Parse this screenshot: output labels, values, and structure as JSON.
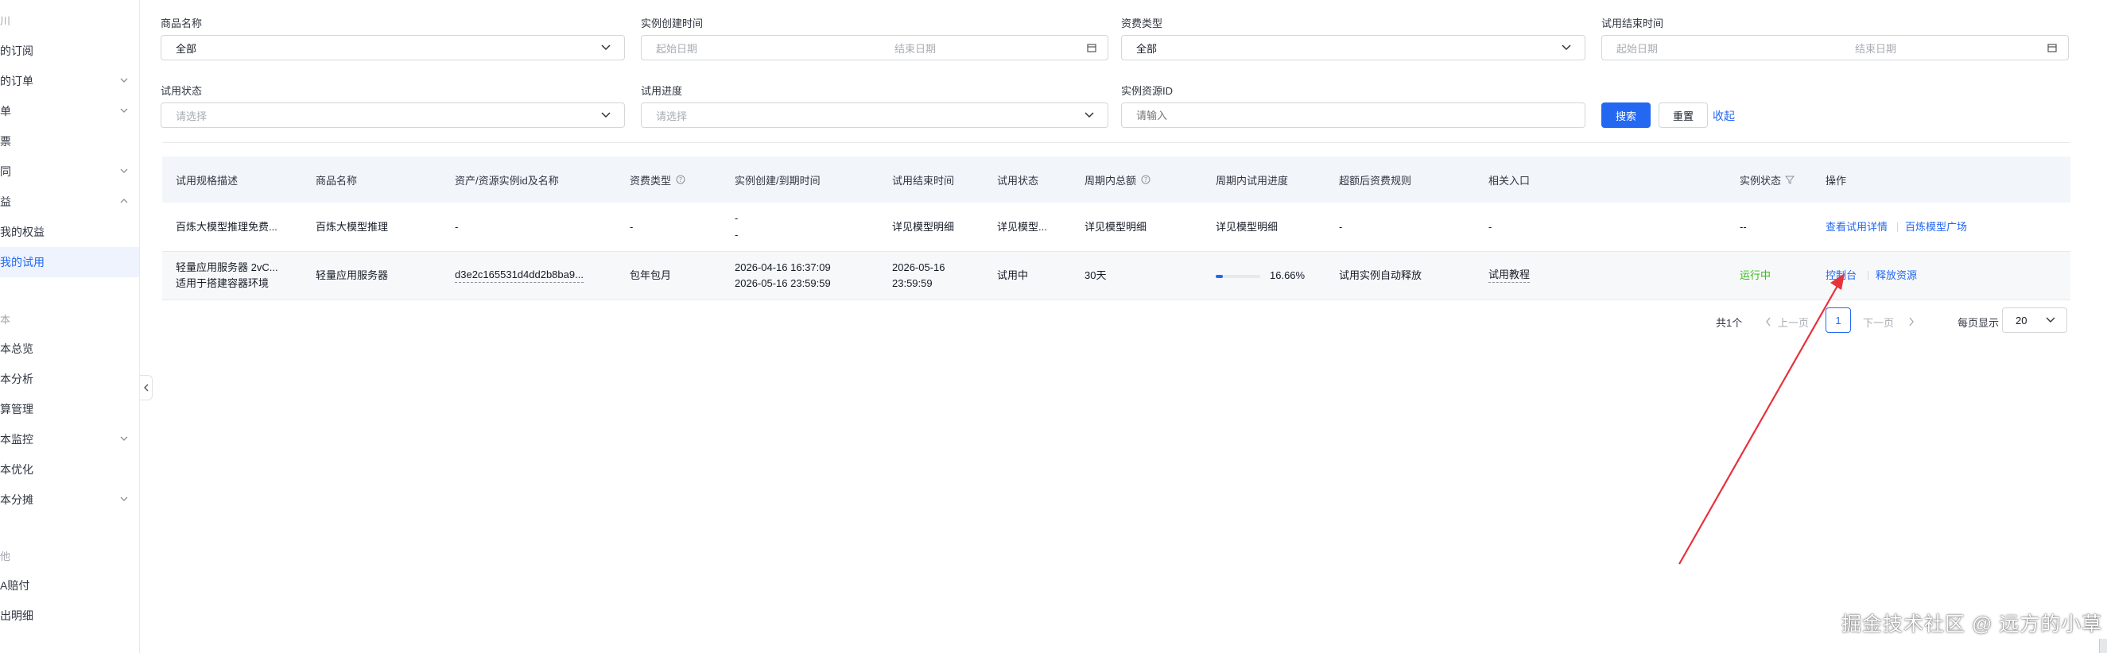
{
  "sidebar": {
    "items": [
      {
        "label": "川",
        "chevron": false,
        "group": true
      },
      {
        "label": "的订阅",
        "chevron": false
      },
      {
        "label": "的订单",
        "chevron": true
      },
      {
        "label": "单",
        "chevron": true
      },
      {
        "label": "票",
        "chevron": false
      },
      {
        "label": "同",
        "chevron": true
      },
      {
        "label": "益",
        "chevron": true,
        "up": true
      },
      {
        "label": "我的权益",
        "chevron": false
      },
      {
        "label": "我的试用",
        "chevron": false,
        "active": true
      },
      {
        "label": "本",
        "chevron": false,
        "group": true
      },
      {
        "label": "本总览",
        "chevron": false
      },
      {
        "label": "本分析",
        "chevron": false
      },
      {
        "label": "算管理",
        "chevron": false
      },
      {
        "label": "本监控",
        "chevron": true
      },
      {
        "label": "本优化",
        "chevron": false
      },
      {
        "label": "本分摊",
        "chevron": true
      },
      {
        "label": "他",
        "chevron": false,
        "group": true
      },
      {
        "label": "A赔付",
        "chevron": false
      },
      {
        "label": "出明细",
        "chevron": false
      }
    ]
  },
  "filters": {
    "product_name": {
      "label": "商品名称",
      "value": "全部"
    },
    "create_time": {
      "label": "实例创建时间",
      "start_placeholder": "起始日期",
      "end_placeholder": "结束日期"
    },
    "billing_type": {
      "label": "资费类型",
      "value": "全部"
    },
    "trial_end_time": {
      "label": "试用结束时间",
      "start_placeholder": "起始日期",
      "end_placeholder": "结束日期"
    },
    "trial_status": {
      "label": "试用状态",
      "placeholder": "请选择"
    },
    "trial_progress": {
      "label": "试用进度",
      "placeholder": "请选择"
    },
    "resource_id": {
      "label": "实例资源ID",
      "placeholder": "请输入"
    },
    "search_label": "搜索",
    "reset_label": "重置",
    "collapse_label": "收起"
  },
  "table": {
    "headers": [
      "试用规格描述",
      "商品名称",
      "资产/资源实例id及名称",
      "资费类型",
      "实例创建/到期时间",
      "试用结束时间",
      "试用状态",
      "周期内总额",
      "周期内试用进度",
      "超额后资费规则",
      "相关入口",
      "实例状态",
      "操作"
    ],
    "rows": [
      {
        "spec": "百炼大模型推理免费...",
        "product": "百炼大模型推理",
        "instance": "-",
        "billing": "-",
        "time_create": "-",
        "time_expire": "-",
        "trial_end": "详见模型明细",
        "trial_status": "详见模型...",
        "total": "详见模型明细",
        "progress_text": "详见模型明细",
        "overage": "-",
        "entry": "-",
        "instance_status": "--",
        "action1": "查看试用详情",
        "action2": "百炼模型广场"
      },
      {
        "spec": "轻量应用服务器 2vC...",
        "spec2": "适用于搭建容器环境",
        "product": "轻量应用服务器",
        "instance": "d3e2c165531d4dd2b8ba9...",
        "billing": "包年包月",
        "time_create": "2026-04-16 16:37:09",
        "time_expire": "2026-05-16 23:59:59",
        "trial_end": "2026-05-16",
        "trial_end2": "23:59:59",
        "trial_status": "试用中",
        "total": "30天",
        "progress_value": 16.66,
        "progress_text": "16.66%",
        "overage": "试用实例自动释放",
        "entry": "试用教程",
        "instance_status": "运行中",
        "action1": "控制台",
        "action2": "释放资源"
      }
    ]
  },
  "pagination": {
    "total": "共1个",
    "prev": "上一页",
    "page": "1",
    "next": "下一页",
    "per_page_label": "每页显示",
    "per_page": "20"
  },
  "colors": {
    "primary": "#2468f2",
    "running": "#30bf13",
    "annotation": "#e8323c"
  },
  "watermark": "掘金技术社区 @ 远方的小草"
}
